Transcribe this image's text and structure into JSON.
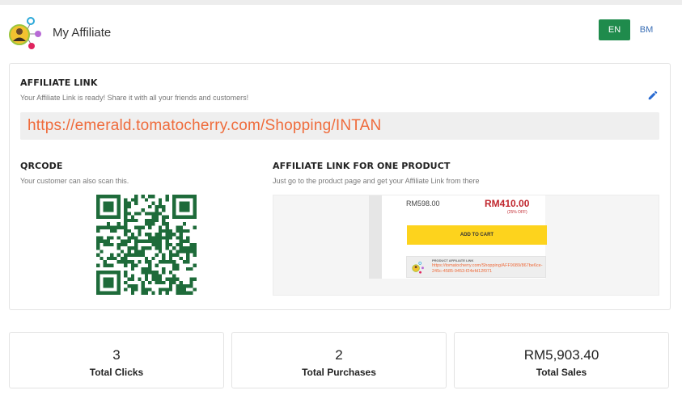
{
  "header": {
    "title": "My Affiliate",
    "languages": [
      "EN",
      "BM"
    ],
    "active_language": "EN"
  },
  "affiliate_link": {
    "title": "AFFILIATE LINK",
    "subtitle": "Your Affiliate Link is ready! Share it with all your friends and customers!",
    "url": "https://emerald.tomatocherry.com/Shopping/INTAN"
  },
  "qrcode": {
    "title": "QRCODE",
    "subtitle": "Your customer can also scan this."
  },
  "one_product": {
    "title": "AFFILIATE LINK FOR ONE PRODUCT",
    "subtitle": "Just go to the product page and get your Affiliate Link from there",
    "preview": {
      "old_price": "RM598.00",
      "new_price": "RM410.00",
      "discount": "(25% OFF)",
      "add_to_cart": "ADD TO CART",
      "product_link_label": "PRODUCT AFFILIATE LINK",
      "product_link": "https://tomatocherry.com/Shopping/AFF9089/867be6ce-245c-4585-9453-f24efd12f071"
    }
  },
  "stats": [
    {
      "value": "3",
      "label": "Total Clicks"
    },
    {
      "value": "2",
      "label": "Total Purchases"
    },
    {
      "value": "RM5,903.40",
      "label": "Total Sales"
    }
  ],
  "colors": {
    "brand_green": "#1f8b4c",
    "link_orange": "#ef6b3b",
    "price_red": "#c0262d",
    "cart_yellow": "#fdd31d",
    "qr_green": "#1e6b3a"
  }
}
